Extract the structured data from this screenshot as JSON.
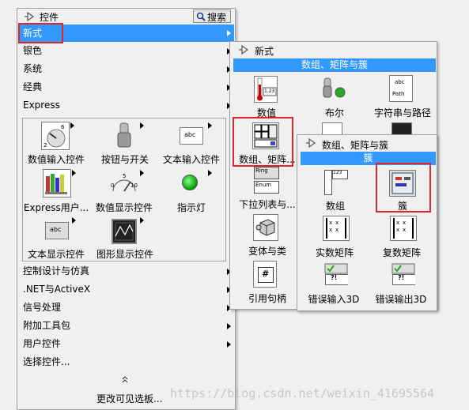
{
  "palette_main": {
    "header_title": "控件",
    "search_label": "搜索",
    "menu_items": [
      "新式",
      "银色",
      "系统",
      "经典",
      "Express"
    ],
    "express_items": [
      "数值输入控件",
      "按钮与开关",
      "文本输入控件",
      "Express用户...",
      "数值显示控件",
      "指示灯",
      "文本显示控件",
      "图形显示控件"
    ],
    "lower_items": [
      "控制设计与仿真",
      ".NET与ActiveX",
      "信号处理",
      "附加工具包",
      "用户控件",
      "选择控件..."
    ],
    "footer_label": "更改可见选板..."
  },
  "palette_modern": {
    "header_title": "新式",
    "bar_title": "数组、矩阵与簇",
    "items": [
      "数值",
      "布尔",
      "字符串与路径",
      "数组、矩阵...",
      "",
      "",
      "下拉列表与...",
      "",
      "",
      "变体与类",
      "",
      "",
      "引用句柄"
    ]
  },
  "palette_array": {
    "header_title": "数组、矩阵与簇",
    "bar_title": "簇",
    "items": [
      "数组",
      "簇",
      "实数矩阵",
      "复数矩阵",
      "错误输入3D",
      "错误输出3D"
    ]
  },
  "icon_texts": {
    "num_digits": "1.23",
    "str_top": "abc",
    "str_bottom": "Path",
    "ring_top": "Ring",
    "ring_bottom": "Enum",
    "ref_symbol": "#",
    "arr_cells": [
      "1",
      "2",
      "3",
      "4"
    ],
    "num_display": "123",
    "mtx_x": "x",
    "err_q": "?!",
    "text_abc": "abc",
    "dial_ticks": [
      "0",
      "5",
      "10"
    ]
  },
  "watermark": "https://blog.csdn.net/weixin_41695564",
  "colors": {
    "selection": "#3399ff",
    "annotation": "#e0262a"
  }
}
